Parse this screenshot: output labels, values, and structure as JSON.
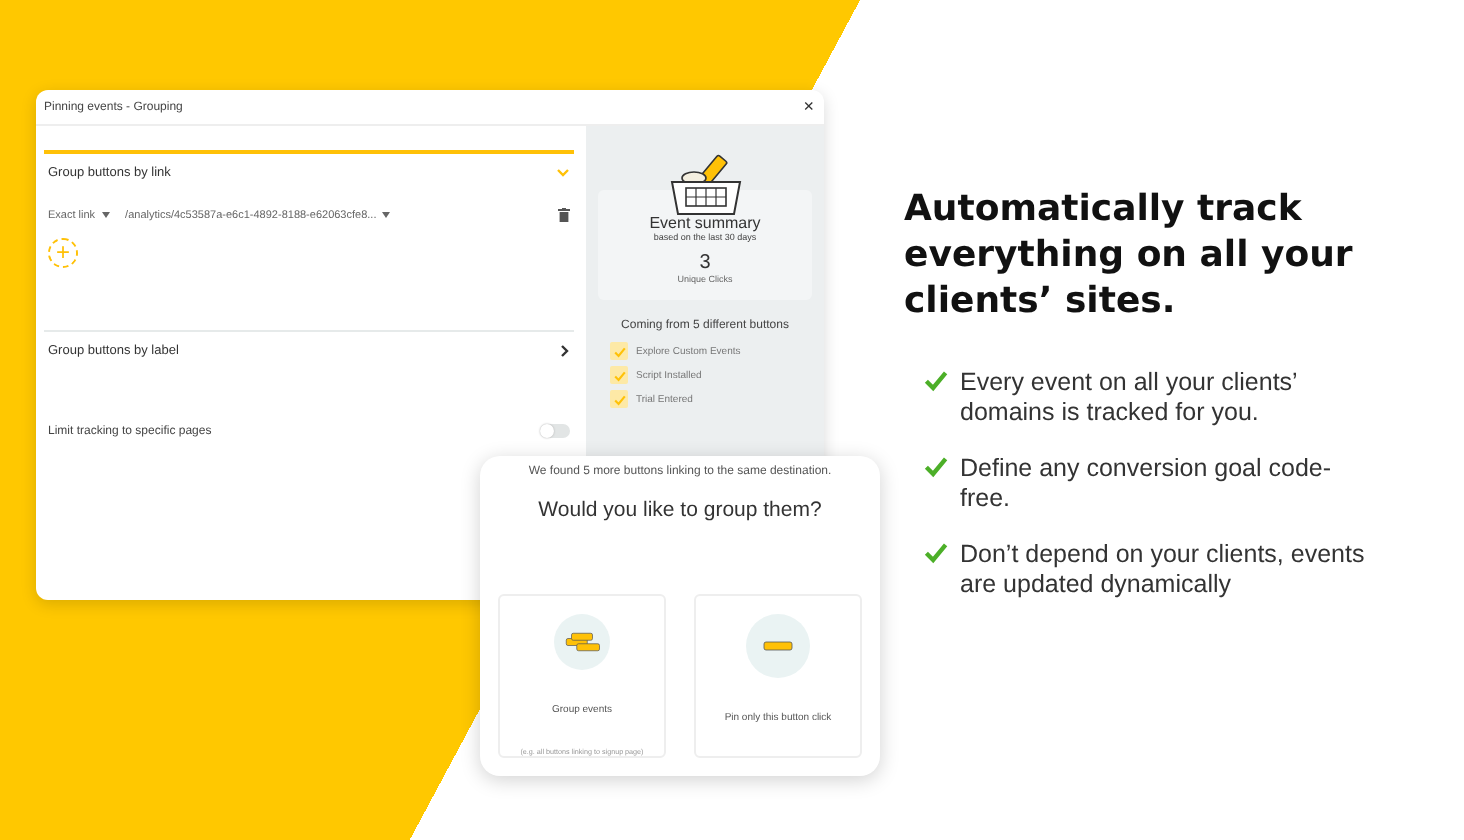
{
  "window": {
    "title": "Pinning events - Grouping",
    "close": "×"
  },
  "sections": [
    {
      "kind": "link_rules",
      "title": "Group buttons by link",
      "expanded": true,
      "rules": [
        {
          "match": "Exact link",
          "path": "/analytics/4c53587a-e6c1-4892-8188-e62063cfe8..."
        }
      ],
      "add": "+"
    },
    {
      "title": "Group buttons by label",
      "expanded": false
    }
  ],
  "limit_tracking": {
    "label": "Limit tracking to specific pages",
    "on": false
  },
  "summary": {
    "title": "Event summary",
    "subtitle": "based on the last 30 days",
    "count": "3",
    "count_label": "Unique Clicks",
    "sources_title": "Coming from 5 different buttons",
    "sources": [
      {
        "label": "Explore Custom Events",
        "checked": true
      },
      {
        "label": "Script Installed",
        "checked": true
      },
      {
        "label": "Trial Entered",
        "checked": true
      }
    ]
  },
  "dialog": {
    "message": "We found 5 more buttons linking to the same destination.",
    "question": "Would you like to group them?",
    "options": [
      {
        "kind": "group",
        "label": "Group events",
        "hint": "(e.g. all buttons linking to signup page)"
      },
      {
        "kind": "single",
        "label": "Pin only this button click"
      }
    ]
  },
  "hero": {
    "heading": "Automatically track everything on all your clients’ sites.",
    "bullets": [
      "Every event on all your clients’ domains is tracked for you.",
      "Define any conversion goal code-free.",
      "Don’t depend on your clients, events are updated dynamically"
    ]
  }
}
